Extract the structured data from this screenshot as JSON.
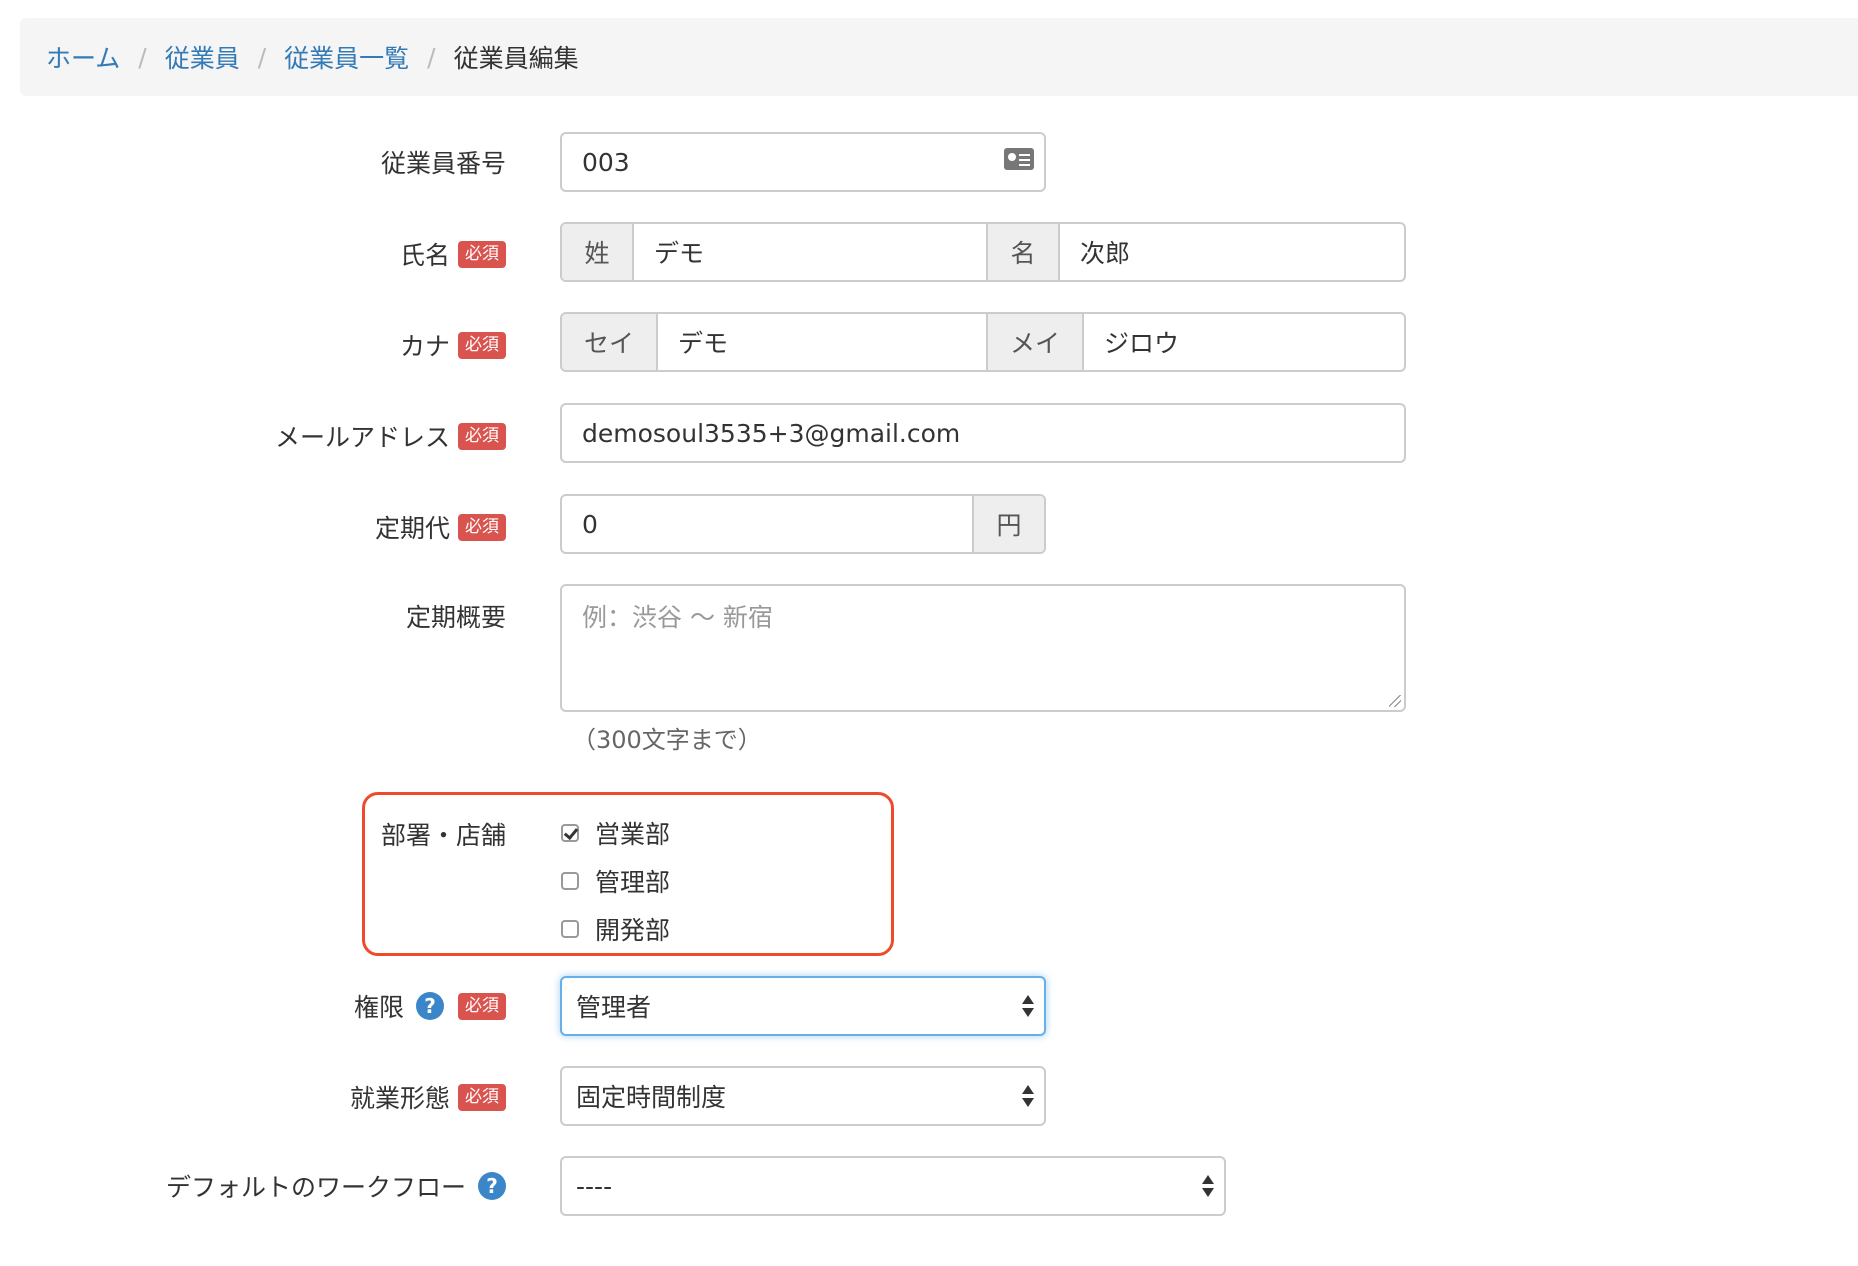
{
  "breadcrumb": {
    "home": "ホーム",
    "employees": "従業員",
    "employee_list": "従業員一覧",
    "current": "従業員編集",
    "separator": "/"
  },
  "required_badge": "必須",
  "help_glyph": "?",
  "employee_number": {
    "label": "従業員番号",
    "value": "003",
    "icon": "id-card-icon"
  },
  "name": {
    "label": "氏名",
    "last_addon": "姓",
    "last_value": "デモ",
    "first_addon": "名",
    "first_value": "次郎"
  },
  "kana": {
    "label": "カナ",
    "last_addon": "セイ",
    "last_value": "デモ",
    "first_addon": "メイ",
    "first_value": "ジロウ"
  },
  "email": {
    "label": "メールアドレス",
    "value": "demosoul3535+3@gmail.com"
  },
  "commute_cost": {
    "label": "定期代",
    "value": "0",
    "unit": "円"
  },
  "commute_summary": {
    "label": "定期概要",
    "placeholder": "例：渋谷 〜 新宿",
    "hint": "（300文字まで）"
  },
  "departments": {
    "label": "部署・店舗",
    "items": [
      {
        "label": "営業部",
        "checked": true
      },
      {
        "label": "管理部",
        "checked": false
      },
      {
        "label": "開発部",
        "checked": false
      }
    ]
  },
  "permission": {
    "label": "権限",
    "selected": "管理者"
  },
  "work_style": {
    "label": "就業形態",
    "selected": "固定時間制度"
  },
  "default_workflow": {
    "label": "デフォルトのワークフロー",
    "selected": "----"
  },
  "colors": {
    "link": "#337ab7",
    "required_badge": "#d9534f",
    "highlight_border": "#ee4b2b",
    "help_icon": "#3a86c8"
  }
}
